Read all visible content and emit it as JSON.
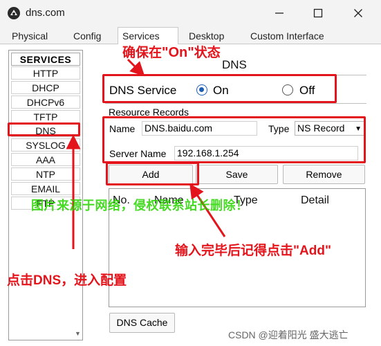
{
  "window": {
    "title": "dns.com",
    "icon": "packet-tracer-icon"
  },
  "tabs": [
    {
      "label": "Physical",
      "active": false
    },
    {
      "label": "Config",
      "active": false
    },
    {
      "label": "Services",
      "active": true
    },
    {
      "label": "Desktop",
      "active": false
    },
    {
      "label": "Custom Interface",
      "active": false
    }
  ],
  "services": {
    "header": "SERVICES",
    "items": [
      "HTTP",
      "DHCP",
      "DHCPv6",
      "TFTP",
      "DNS",
      "SYSLOG",
      "AAA",
      "NTP",
      "EMAIL",
      "FTP"
    ],
    "selected": "DNS"
  },
  "dns_panel": {
    "title": "DNS",
    "service_label": "DNS Service",
    "on_label": "On",
    "off_label": "Off",
    "service_state": "On",
    "resource_records_label": "Resource Records",
    "name_label": "Name",
    "name_value": "DNS.baidu.com",
    "type_label": "Type",
    "type_value": "NS Record",
    "server_name_label": "Server Name",
    "server_name_value": "192.168.1.254",
    "add_button": "Add",
    "save_button": "Save",
    "remove_button": "Remove",
    "columns": [
      "No.",
      "Name",
      "Type",
      "Detail"
    ],
    "dns_cache_button": "DNS Cache"
  },
  "annotations": {
    "ensure_on": {
      "prefix": "确保在",
      "quote": "\"On\"",
      "suffix": "状态"
    },
    "click_dns": "点击DNS，进入配置",
    "click_add": {
      "prefix": "输入完毕后记得点击",
      "quote": "\"Add\""
    },
    "watermark": "图片来源于网络，侵权联系站长删除！",
    "credit": "CSDN @迎着阳光 盛大逃亡"
  },
  "colors": {
    "annotation_red": "#e3141b",
    "radio_blue": "#1a5fb4",
    "watermark_green": "#28d400"
  }
}
